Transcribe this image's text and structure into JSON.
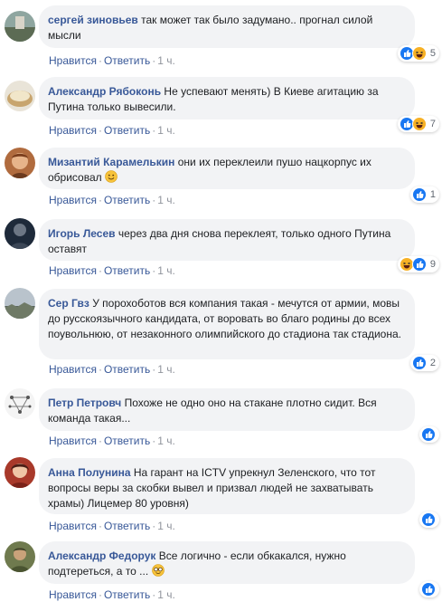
{
  "comments": [
    {
      "author": "сергей зиновьев",
      "text": "так может так было задумано.. прогнал силой мысли",
      "reaction_count": "5",
      "reactions": [
        "like",
        "haha"
      ],
      "like": "Нравится",
      "reply": "Ответить",
      "time": "1 ч."
    },
    {
      "author": "Александр Рябоконь",
      "text": "Не успевают менять) В Киеве агитацию за Путина только вывесили.",
      "reaction_count": "7",
      "reactions": [
        "like",
        "haha"
      ],
      "like": "Нравится",
      "reply": "Ответить",
      "time": "1 ч."
    },
    {
      "author": "Мизантий Карамелькин",
      "text": "они их переклеили пушо нацкорпус их обрисовал",
      "reaction_count": "1",
      "reactions": [
        "like"
      ],
      "like": "Нравится",
      "reply": "Ответить",
      "time": "1 ч."
    },
    {
      "author": "Игорь Лесев",
      "text": "через два дня снова переклеят, только одного Путина оставят",
      "reaction_count": "9",
      "reactions": [
        "haha",
        "like"
      ],
      "like": "Нравится",
      "reply": "Ответить",
      "time": "1 ч."
    },
    {
      "author": "Сер Гвз",
      "text": "У порохоботов вся компания такая - мечутся от армии, мовы до русскоязычного кандидата, от воровать во благо родины до всех поувольнюю, от незаконного олимпийского до стадиона так стадиона.",
      "reaction_count": "2",
      "reactions": [
        "like"
      ],
      "like": "Нравится",
      "reply": "Ответить",
      "time": "1 ч."
    },
    {
      "author": "Петр Петровч",
      "text": "Похоже не одно оно на стакане плотно сидит. Вся команда такая...",
      "reaction_count": "",
      "reactions": [
        "like"
      ],
      "like": "Нравится",
      "reply": "Ответить",
      "time": "1 ч."
    },
    {
      "author": "Анна Полунина",
      "text": "На гарант на ICTV упрекнул Зеленского, что тот вопросы веры за скобки вывел и призвал людей не захватывать храмы) Лицемер 80 уровня)",
      "reaction_count": "",
      "reactions": [
        "like"
      ],
      "like": "Нравится",
      "reply": "Ответить",
      "time": "1 ч."
    },
    {
      "author": "Александр Федорук",
      "text": "Все логично - если обкакался, нужно подтереться, а то ...",
      "reaction_count": "",
      "reactions": [
        "like"
      ],
      "like": "Нравится",
      "reply": "Ответить",
      "time": "1 ч."
    }
  ],
  "colors": {
    "author": "#385898",
    "bubble": "#f2f3f5",
    "meta": "#90949c",
    "like_blue": "#1877f2",
    "haha_yellow": "#f7b125"
  }
}
